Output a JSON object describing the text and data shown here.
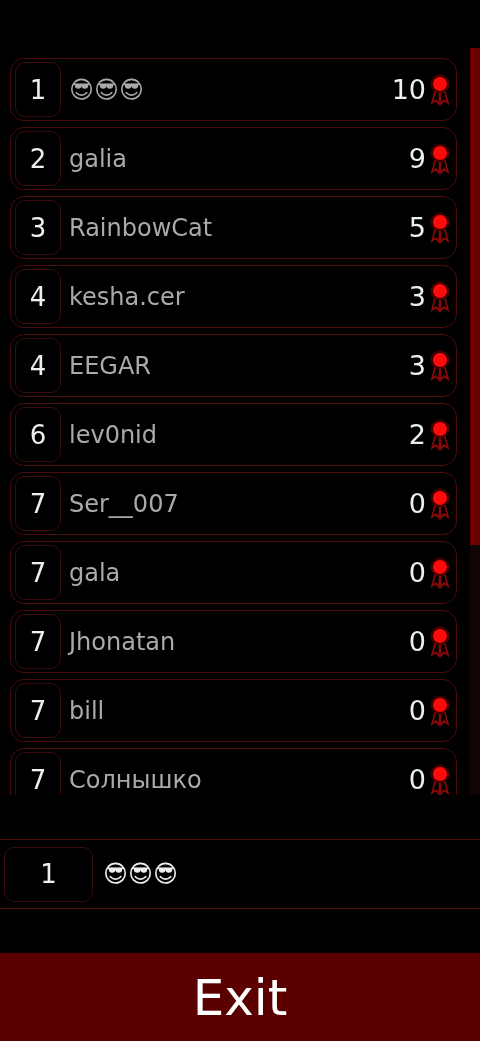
{
  "leaderboard": [
    {
      "rank": "1",
      "name": "😎😎😎",
      "score": "10"
    },
    {
      "rank": "2",
      "name": "galia",
      "score": "9"
    },
    {
      "rank": "3",
      "name": "RainbowCat",
      "score": "5"
    },
    {
      "rank": "4",
      "name": "kesha.cer",
      "score": "3"
    },
    {
      "rank": "4",
      "name": "EEGAR",
      "score": "3"
    },
    {
      "rank": "6",
      "name": "lev0nid",
      "score": "2"
    },
    {
      "rank": "7",
      "name": "Ser__007",
      "score": "0"
    },
    {
      "rank": "7",
      "name": "gala",
      "score": "0"
    },
    {
      "rank": "7",
      "name": "Jhonatan",
      "score": "0"
    },
    {
      "rank": "7",
      "name": "bill",
      "score": "0"
    },
    {
      "rank": "7",
      "name": "Солнышко",
      "score": "0"
    }
  ],
  "current_player": {
    "rank": "1",
    "name": "😎😎😎"
  },
  "exit_button": "Exit"
}
